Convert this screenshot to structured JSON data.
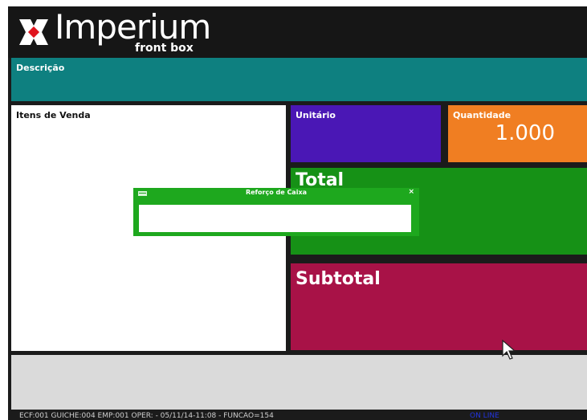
{
  "app": {
    "brand_title": "Imperium",
    "brand_subtitle": "front box"
  },
  "panels": {
    "descricao_label": "Descrição",
    "itens_label": "Itens de Venda",
    "unitario_label": "Unitário",
    "quantidade_label": "Quantidade",
    "quantidade_value": "1.000",
    "total_label": "Total",
    "subtotal_label": "Subtotal"
  },
  "dialog": {
    "title": "Reforço de Caixa",
    "close_label": "×",
    "input_value": ""
  },
  "statusbar": {
    "info": "ECF:001 GUICHE:004 EMP:001 OPER: -    05/11/14-11:08  -  FUNCAO=154",
    "online": "ON LINE"
  },
  "colors": {
    "descricao": "#0e8080",
    "unitario": "#4a17b5",
    "quantidade": "#f07e22",
    "total": "#169116",
    "subtotal": "#a81247",
    "dialog": "#1ea81e",
    "online": "#2233dd"
  },
  "icons": {
    "logo": "imperium-logo-icon",
    "dialog_menu": "window-menu-icon",
    "dialog_close": "close-icon",
    "pointer": "mouse-cursor-icon"
  }
}
